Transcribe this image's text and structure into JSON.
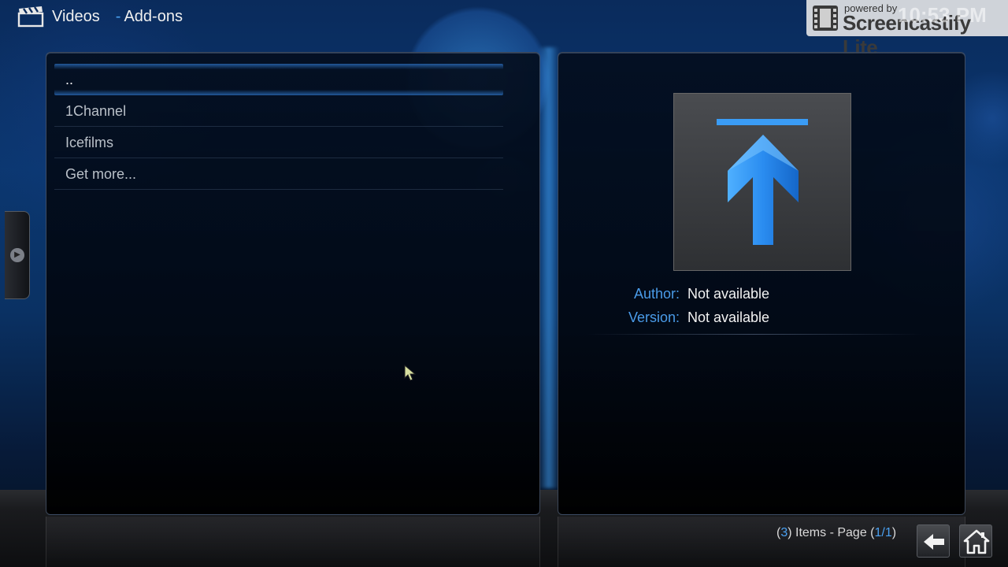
{
  "header": {
    "section": "Videos",
    "separator": "-",
    "subsection": "Add-ons"
  },
  "watermark": {
    "powered_by": "powered by",
    "brand": "Screencastify Lite"
  },
  "clock": "10:53 PM",
  "list": {
    "items": [
      {
        "label": ".."
      },
      {
        "label": "1Channel"
      },
      {
        "label": "Icefilms"
      },
      {
        "label": "Get more..."
      }
    ],
    "focused_index": 0
  },
  "details": {
    "author_label": "Author:",
    "author_value": "Not available",
    "version_label": "Version:",
    "version_value": "Not available",
    "thumbnail_icon": "upload-arrow-icon"
  },
  "footer": {
    "items_open": "(",
    "items_count": "3",
    "items_mid": ") Items - Page (",
    "page": "1/1",
    "items_close": ")"
  },
  "colors": {
    "accent": "#4aa0f0",
    "arrow_blue": "#1f7fe0"
  }
}
